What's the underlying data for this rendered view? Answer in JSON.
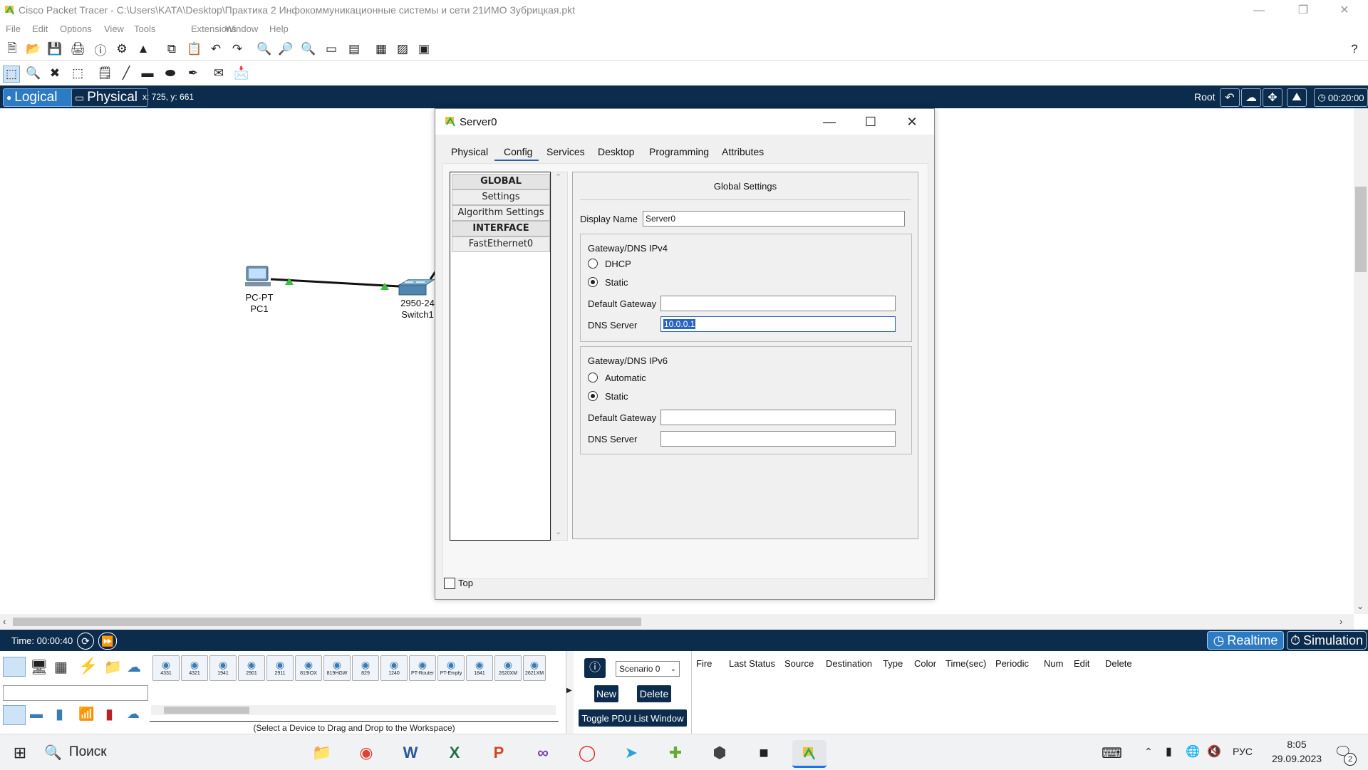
{
  "window": {
    "title": "Cisco Packet Tracer - C:\\Users\\KATA\\Desktop\\Практика 2 Инфокоммуникационные системы и сети 21ИМО Зубрицкая.pkt"
  },
  "menu": [
    "File",
    "Edit",
    "Options",
    "View",
    "Tools",
    "Extensions",
    "Window",
    "Help"
  ],
  "logical_bar": {
    "logical_label": "Logical",
    "physical_label": "Physical",
    "coords": "x: 725, y: 661",
    "root_label": "Root",
    "clock": "00:20:00"
  },
  "workspace": {
    "devices": [
      {
        "type": "PC-PT",
        "name": "PC1"
      },
      {
        "type": "2950-24",
        "name": "Switch1"
      }
    ],
    "link_status_color": "#3fbf3f"
  },
  "dialog": {
    "title": "Server0",
    "tabs": [
      "Physical",
      "Config",
      "Services",
      "Desktop",
      "Programming",
      "Attributes"
    ],
    "active_tab": "Config",
    "left_list": [
      "GLOBAL",
      "Settings",
      "Algorithm Settings",
      "INTERFACE",
      "FastEthernet0"
    ],
    "panel_title": "Global Settings",
    "display_name_label": "Display Name",
    "display_name_value": "Server0",
    "ipv4": {
      "group_label": "Gateway/DNS IPv4",
      "dhcp_label": "DHCP",
      "static_label": "Static",
      "selected": "Static",
      "default_gateway_label": "Default Gateway",
      "default_gateway_value": "",
      "dns_server_label": "DNS Server",
      "dns_server_value": "10.0.0.1"
    },
    "ipv6": {
      "group_label": "Gateway/DNS IPv6",
      "automatic_label": "Automatic",
      "static_label": "Static",
      "selected": "Static",
      "default_gateway_label": "Default Gateway",
      "default_gateway_value": "",
      "dns_server_label": "DNS Server",
      "dns_server_value": ""
    },
    "top_checkbox_label": "Top",
    "top_checked": false
  },
  "bottom": {
    "time_label": "Time: 00:00:40",
    "realtime_label": "Realtime",
    "simulation_label": "Simulation",
    "device_models": [
      "4331",
      "4321",
      "1941",
      "2901",
      "2911",
      "819IOX",
      "819HGW",
      "829",
      "1240",
      "PT-Router",
      "PT-Empty",
      "1841",
      "2620XM",
      "2621XM"
    ],
    "hint": "(Select a Device to Drag and Drop to the Workspace)",
    "scenario": "Scenario 0",
    "new_label": "New",
    "delete_label": "Delete",
    "toggle_pdu_label": "Toggle PDU List Window",
    "pdu_columns": [
      "Fire",
      "Last Status",
      "Source",
      "Destination",
      "Type",
      "Color",
      "Time(sec)",
      "Periodic",
      "Num",
      "Edit",
      "Delete"
    ]
  },
  "taskbar": {
    "search_label": "Поиск",
    "language": "РУС",
    "time": "8:05",
    "date": "29.09.2023",
    "notification_count": "2"
  }
}
